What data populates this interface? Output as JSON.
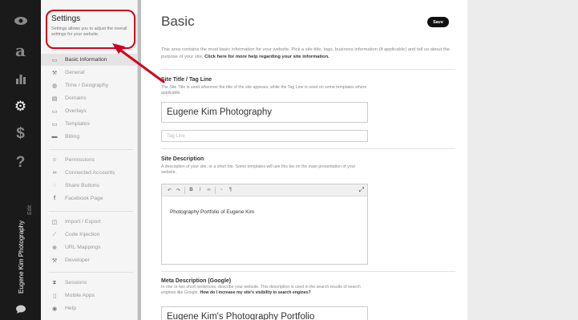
{
  "rail": {
    "icons": [
      "eye-icon",
      "typeface-a-icon",
      "bar-chart-icon",
      "gear-icon",
      "dollar-icon",
      "question-icon",
      "chat-icon"
    ],
    "site_name": "Eugene Kim Photography",
    "site_sub": "Edit"
  },
  "sidebar": {
    "title": "Settings",
    "description": "Settings allows you to adjust the overall settings for your website.",
    "items": [
      {
        "label": "Basic Information",
        "icon": "id-card-icon"
      },
      {
        "label": "General",
        "icon": "wrench-icon"
      },
      {
        "label": "Time / Geography",
        "icon": "globe-icon"
      },
      {
        "label": "Domains",
        "icon": "domain-icon"
      },
      {
        "label": "Overlays",
        "icon": "overlay-icon"
      },
      {
        "label": "Templates",
        "icon": "template-icon"
      },
      {
        "label": "Billing",
        "icon": "credit-card-icon"
      },
      {
        "label": "Permissions",
        "icon": "person-icon"
      },
      {
        "label": "Connected Accounts",
        "icon": "link-icon"
      },
      {
        "label": "Share Buttons",
        "icon": "share-icon"
      },
      {
        "label": "Facebook Page",
        "icon": "facebook-icon"
      },
      {
        "label": "Import / Export",
        "icon": "database-icon"
      },
      {
        "label": "Code Injection",
        "icon": "code-icon"
      },
      {
        "label": "URL Mappings",
        "icon": "arrow-circle-icon"
      },
      {
        "label": "Developer",
        "icon": "hammer-icon"
      },
      {
        "label": "Sessions",
        "icon": "hourglass-icon"
      },
      {
        "label": "Mobile Apps",
        "icon": "phone-icon"
      },
      {
        "label": "Help",
        "icon": "help-icon"
      }
    ]
  },
  "main": {
    "title": "Basic",
    "save_label": "Save",
    "intro_text": "This area contains the most basic information for your website. Pick a site title, logo, business information (if applicable) and tell us about the purpose of your site.",
    "intro_link": "Click here for more help regarding your site information.",
    "site_title": {
      "heading": "Site Title / Tag Line",
      "description": "The Site Title is used wherever the title of the site appears, while the Tag Line is used on some templates where applicable.",
      "title_value": "Eugene Kim Photography",
      "tagline_placeholder": "Tag Line"
    },
    "site_description": {
      "heading": "Site Description",
      "description": "A description of your site, or a short bio. Some templates will use this bio on the main presentation of your website.",
      "toolbar": [
        "↶",
        "↷",
        "B",
        "I",
        "∞",
        "▫",
        "¶"
      ],
      "body_text": "Photography Portfolio of Eugene Kim"
    },
    "meta": {
      "heading": "Meta Description (Google)",
      "description": "In one or two short sentences, describe your website. This description is used in the search results of search engines like Google.",
      "link": "How do I increase my site's visibility in search engines?",
      "value": "Eugene Kim's Photography Portfolio"
    }
  },
  "colors": {
    "accent_red": "#d0021b",
    "rail_bg": "#1a1a1a"
  }
}
